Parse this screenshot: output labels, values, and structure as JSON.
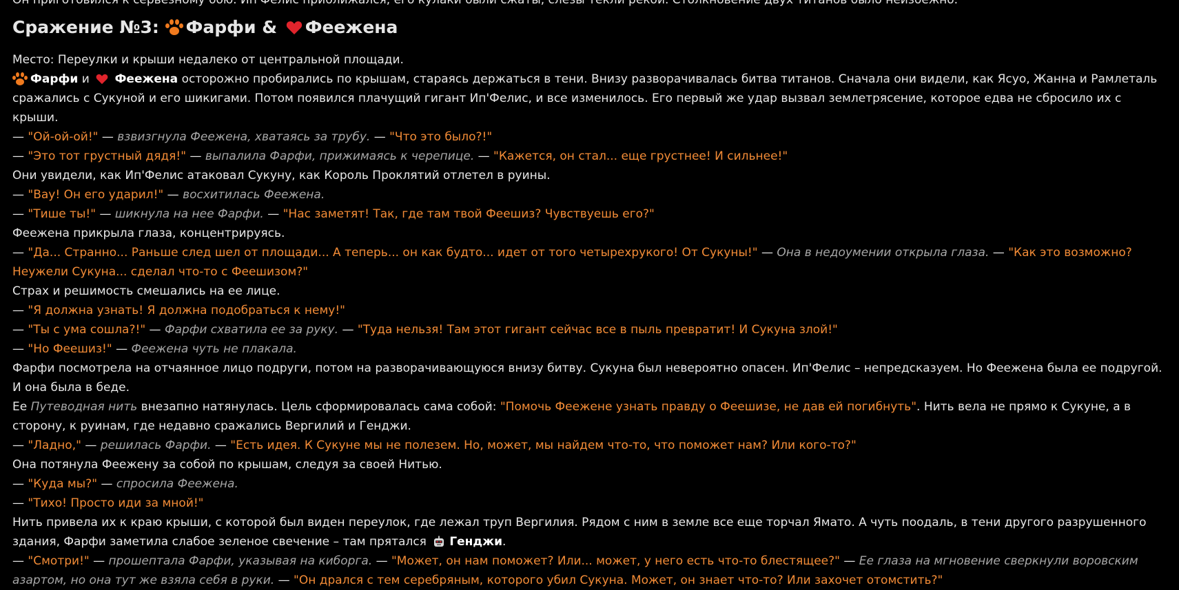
{
  "top_line": "Он приготовился к серьезному бою. Ип'Фелис приближался, его кулаки были сжаты, слезы текли рекой. Столкновение двух титанов было неизбежно.",
  "heading": {
    "prefix": "Сражение №3:",
    "name1": "Фарфи",
    "amp": "&",
    "name2": "Феежена"
  },
  "place": "Место: Переулки и крыши недалеко от центральной площади.",
  "intro": {
    "name1": "Фарфи",
    "and": "и",
    "name2": "Феежена",
    "rest": "осторожно пробирались по крышам, стараясь держаться в тени. Внизу разворачивалась битва титанов. Сначала они видели, как Ясуо, Жанна и Рамлеталь сражались с Сукуной и его шикигами. Потом появился плачущий гигант Ип'Фелис, и все изменилось. Его первый же удар вызвал землетрясение, которое едва не сбросило их с крыши."
  },
  "dash": "—",
  "lines": {
    "l1": {
      "q1": "\"Ой-ой-ой!\"",
      "a1": "взвизгнула Феежена, хватаясь за трубу.",
      "q2": "\"Что это было?!\""
    },
    "l2": {
      "q1": "\"Это тот грустный дядя!\"",
      "a1": "выпалила Фарфи, прижимаясь к черепице.",
      "q2": "\"Кажется, он стал... еще грустнее! И сильнее!\""
    },
    "n1": "Они увидели, как Ип'Фелис атаковал Сукуну, как Король Проклятий отлетел в руины.",
    "l3": {
      "q1": "\"Вау! Он его ударил!\"",
      "a1": "восхитилась Феежена."
    },
    "l4": {
      "q1": "\"Тише ты!\"",
      "a1": "шикнула на нее Фарфи.",
      "q2": "\"Нас заметят! Так, где там твой Феешиз? Чувствуешь его?\""
    },
    "n2": "Феежена прикрыла глаза, концентрируясь.",
    "l5": {
      "q1": "\"Да... Странно... Раньше след шел от площади... А теперь... он как будто... идет от того четырехрукого! От Сукуны!\"",
      "a1": "Она в недоумении открыла глаза.",
      "q2": "\"Как это возможно? Неужели Сукуна... сделал что-то с Феешизом?\""
    },
    "n3": "Страх и решимость смешались на ее лице.",
    "l6": {
      "q1": "\"Я должна узнать! Я должна подобраться к нему!\""
    },
    "l7": {
      "q1": "\"Ты с ума сошла?!\"",
      "a1": "Фарфи схватила ее за руку.",
      "q2": "\"Туда нельзя! Там этот гигант сейчас все в пыль превратит! И Сукуна злой!\""
    },
    "l8": {
      "q1": "\"Но Феешиз!\"",
      "a1": "Феежена чуть не плакала."
    },
    "n4": "Фарфи посмотрела на отчаянное лицо подруги, потом на разворачивающуюся внизу битву. Сукуна был невероятно опасен. Ип'Фелис – непредсказуем. Но Феежена была ее подругой. И она была в беде.",
    "n5": {
      "p1": "Ее",
      "i1": "Путеводная нить",
      "p2": "внезапно натянулась. Цель сформировалась сама собой:",
      "q1": "\"Помочь Феежене узнать правду о Феешизе, не дав ей погибнуть\"",
      "p3": ". Нить вела не прямо к Сукуне, а в сторону, к руинам, где недавно сражались Вергилий и Генджи."
    },
    "l9": {
      "q1": "\"Ладно,\"",
      "a1": "решилась Фарфи.",
      "q2": "\"Есть идея. К Сукуне мы не полезем. Но, может, мы найдем что-то, что поможет нам? Или кого-то?\""
    },
    "n6": "Она потянула Феежену за собой по крышам, следуя за своей Нитью.",
    "l10": {
      "q1": "\"Куда мы?\"",
      "a1": "спросила Феежена."
    },
    "l11": {
      "q1": "\"Тихо! Просто иди за мной!\""
    },
    "n7": {
      "p1": "Нить привела их к краю крыши, с которой был виден переулок, где лежал труп Вергилия. Рядом с ним в земле все еще торчал Ямато. А чуть поодаль, в тени другого разрушенного здания, Фарфи заметила слабое зеленое свечение – там прятался",
      "b1": "Генджи",
      "p2": "."
    },
    "l12": {
      "q1": "\"Смотри!\"",
      "a1": "прошептала Фарфи, указывая на киборга.",
      "q2": "\"Может, он нам поможет? Или... может, у него есть что-то блестящее?\"",
      "a2": "Ее глаза на мгновение сверкнули воровским азартом, но она тут же взяла себя в руки.",
      "q3": "\"Он дрался с тем серебряным, которого убил Сукуна. Может, он знает что-то? Или захочет отомстить?\""
    }
  },
  "colors": {
    "quote": "#f28b36",
    "attribution": "#a6a6a6",
    "text": "#e6e6e6",
    "paw": "#f07a1e",
    "heart": "#e0242c"
  }
}
